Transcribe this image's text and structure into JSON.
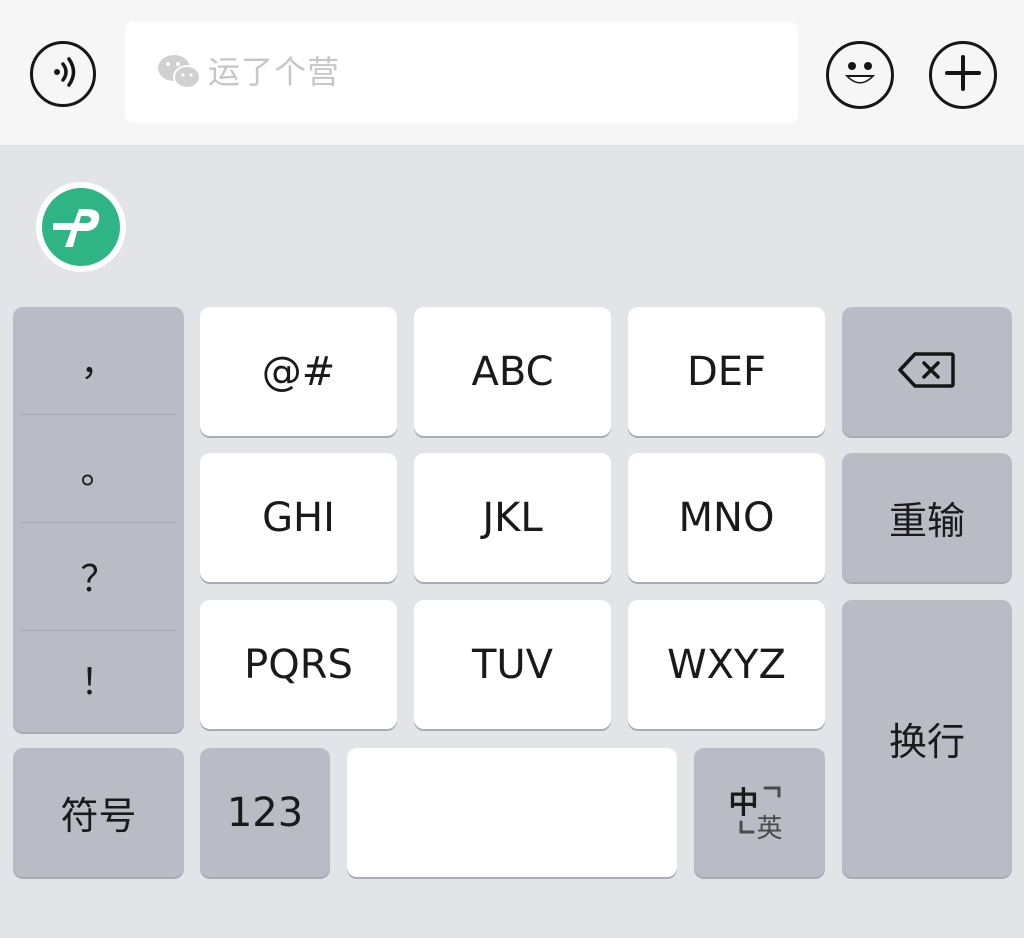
{
  "top_bar": {
    "voice_icon": "voice-icon",
    "input_placeholder": "运了个营",
    "emoji_icon": "emoji-icon",
    "plus_icon": "plus-icon"
  },
  "toolbar": {
    "logo_icon": "app-logo-icon"
  },
  "punctuation": {
    "items": [
      "，",
      "。",
      "？",
      "！"
    ]
  },
  "keys": {
    "k1": "@#",
    "k2": "ABC",
    "k3": "DEF",
    "k4": "GHI",
    "k5": "JKL",
    "k6": "MNO",
    "k7": "PQRS",
    "k8": "TUV",
    "k9": "WXYZ"
  },
  "right_column": {
    "backspace_icon": "backspace-icon",
    "reset": "重输",
    "newline": "换行"
  },
  "bottom_row": {
    "symbols": "符号",
    "numbers": "123",
    "space": "",
    "lang_cn": "中",
    "lang_en": "英"
  },
  "colors": {
    "background": "#e3e4e8",
    "light_key": "#ffffff",
    "dark_key": "#b9bcc5",
    "accent_logo": "#2fb585"
  }
}
